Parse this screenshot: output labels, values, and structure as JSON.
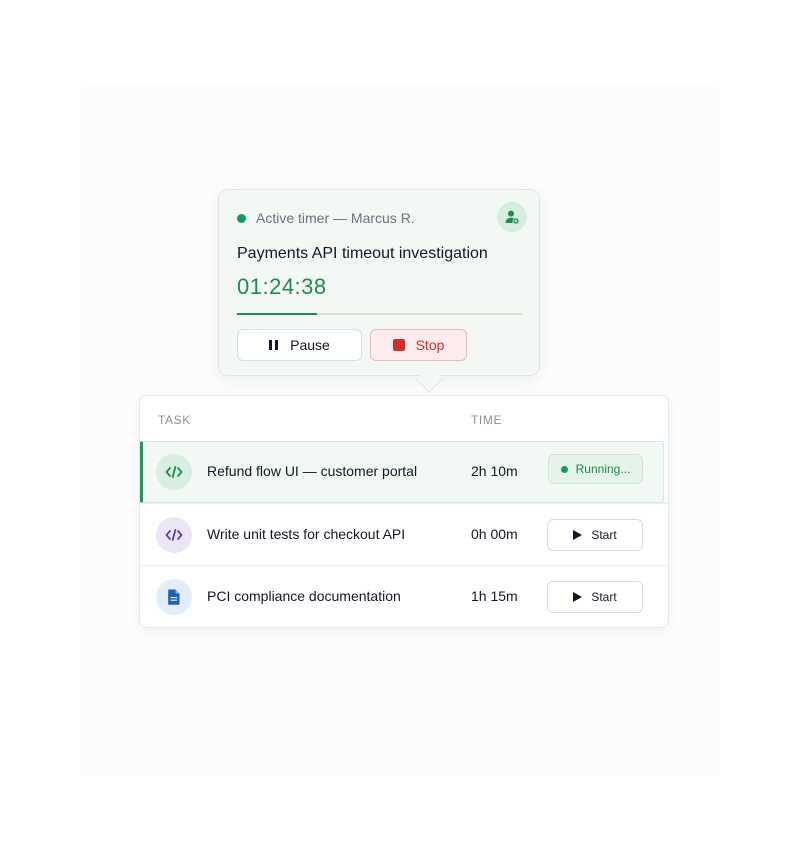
{
  "timer": {
    "status_label": "Active timer — Marcus R.",
    "task_title": "Payments API timeout investigation",
    "elapsed": "01:24:38",
    "progress_fraction": 0.28,
    "pause_label": "Pause",
    "stop_label": "Stop",
    "user_icon": "user-badge-icon",
    "accent_color": "#1f8b4c",
    "stop_color": "#d62b2b"
  },
  "table": {
    "headers": {
      "task": "TASK",
      "time": "TIME"
    },
    "rows": [
      {
        "name": "Refund flow UI — customer portal",
        "time": "2h 10m",
        "icon": "code-icon",
        "status": "Running...",
        "active": true
      },
      {
        "name": "Write unit tests for checkout API",
        "time": "0h 00m",
        "icon": "code-icon",
        "action": "Start",
        "active": false
      },
      {
        "name": "PCI compliance documentation",
        "time": "1h 15m",
        "icon": "document-icon",
        "action": "Start",
        "active": false
      }
    ]
  }
}
